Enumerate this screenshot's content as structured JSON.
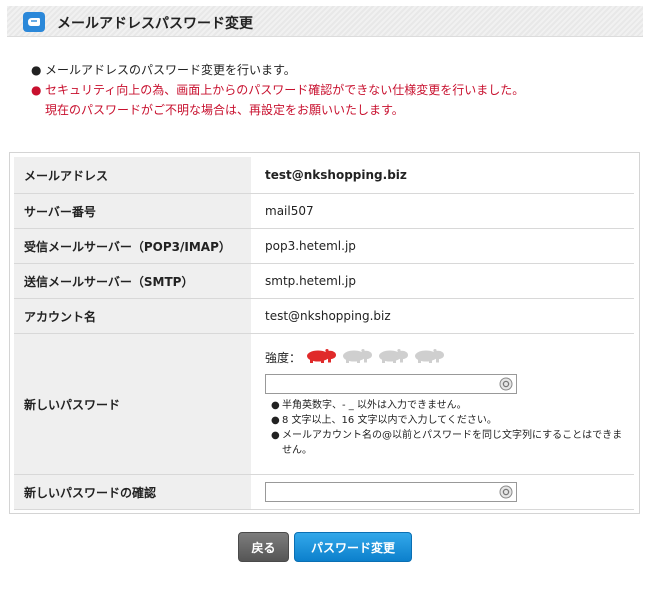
{
  "header": {
    "title": "メールアドレスパスワード変更",
    "icon": "mail-icon",
    "accent": "#2b88d9"
  },
  "notes": [
    {
      "bullet": "●",
      "text": "メールアドレスのパスワード変更を行います。",
      "color": "#222222"
    },
    {
      "bullet": "●",
      "text": "セキュリティ向上の為、画面上からのパスワード確認ができない仕様変更を行いました。",
      "color": "#c8102e"
    },
    {
      "bullet": "",
      "text": "現在のパスワードがご不明な場合は、再設定をお願いいたします。",
      "color": "#c8102e"
    }
  ],
  "form": {
    "email": {
      "label": "メールアドレス",
      "value": "test@nkshopping.biz"
    },
    "server": {
      "label": "サーバー番号",
      "value": "mail507"
    },
    "pop": {
      "label": "受信メールサーバー（POP3/IMAP）",
      "value": "pop3.heteml.jp"
    },
    "smtp": {
      "label": "送信メールサーバー（SMTP）",
      "value": "smtp.heteml.jp"
    },
    "account": {
      "label": "アカウント名",
      "value": "test@nkshopping.biz"
    },
    "newpw": {
      "label": "新しいパスワード",
      "strength_label": "強度：",
      "strength_level": 1,
      "strength_max": 4,
      "strength_color_active": "#e02a2a",
      "strength_color_inactive": "#cfcfcf",
      "value": "",
      "hints": [
        "半角英数字、- _ 以外は入力できません。",
        "8 文字以上、16 文字以内で入力してください。",
        "メールアカウント名の@以前とパスワードを同じ文字列にすることはできません。"
      ]
    },
    "confirm": {
      "label": "新しいパスワードの確認",
      "value": ""
    }
  },
  "buttons": {
    "back": "戻る",
    "submit": "パスワード変更"
  }
}
